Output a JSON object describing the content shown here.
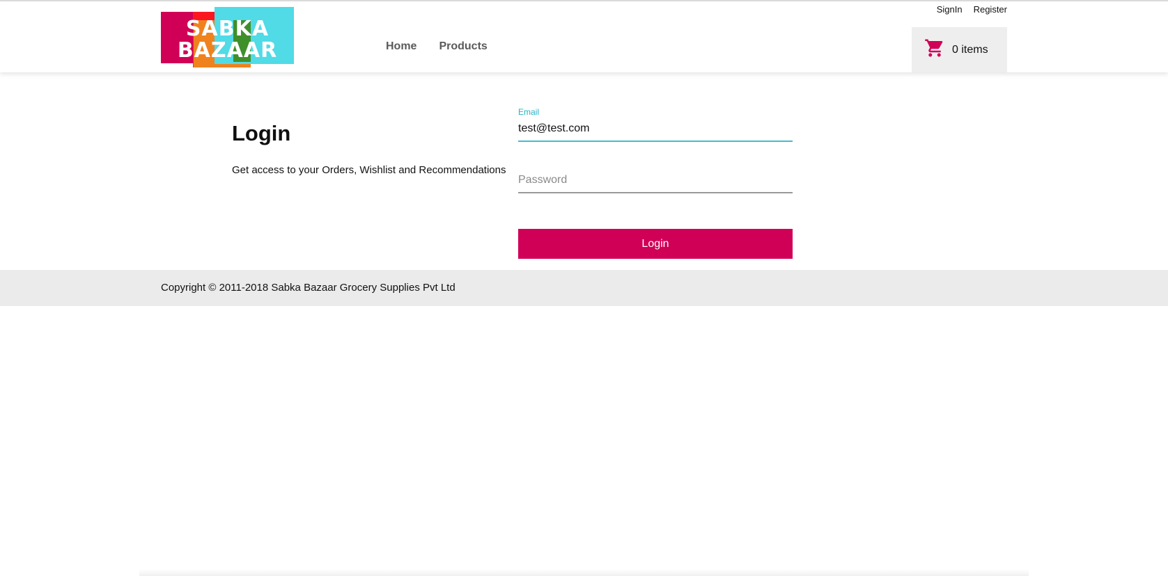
{
  "brand": {
    "logo_line1": "SABKA",
    "logo_line2": "BAZAAR",
    "colors": {
      "primary": "#d10057",
      "accent": "#3cbfcf",
      "logo_cyan": "#50dbe6",
      "logo_orange": "#f0821e",
      "logo_green": "#3f8f2a"
    }
  },
  "header": {
    "nav": {
      "home": "Home",
      "products": "Products"
    },
    "auth": {
      "signin": "SignIn",
      "register": "Register"
    },
    "cart": {
      "icon": "cart-icon",
      "count_label": "0 items"
    }
  },
  "login": {
    "title": "Login",
    "subtitle": "Get access to your Orders, Wishlist and Recommendations",
    "email": {
      "label": "Email",
      "value": "test@test.com"
    },
    "password": {
      "placeholder": "Password",
      "value": ""
    },
    "submit_label": "Login"
  },
  "footer": {
    "copyright": "Copyright © 2011-2018 Sabka Bazaar Grocery Supplies Pvt Ltd"
  }
}
